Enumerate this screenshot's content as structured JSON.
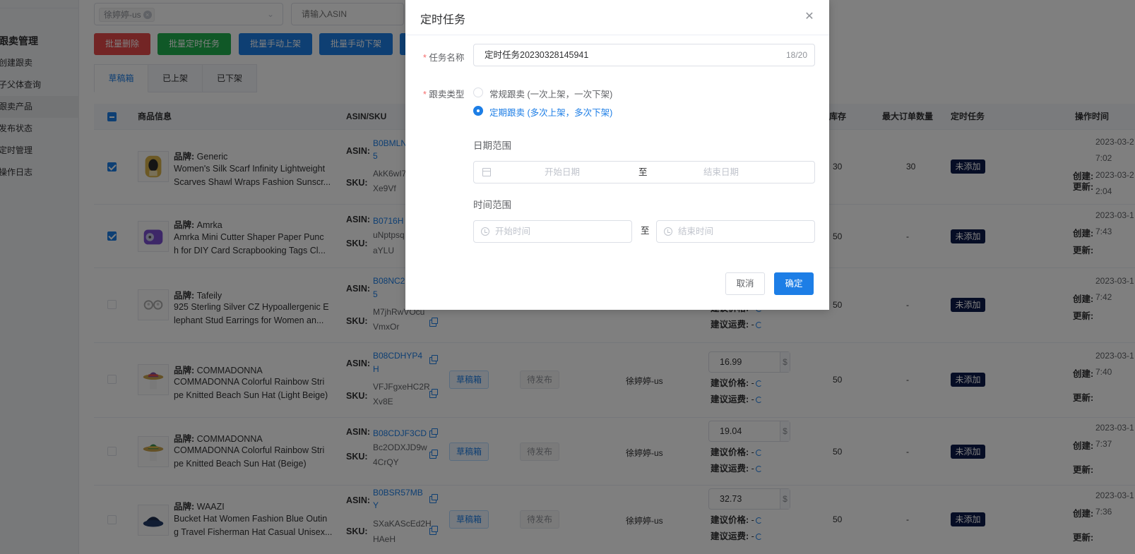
{
  "sidebar": {
    "group_title": "跟卖管理",
    "items": [
      {
        "label": "创建跟卖"
      },
      {
        "label": "子父体查询"
      },
      {
        "label": "跟卖产品"
      },
      {
        "label": "发布状态"
      },
      {
        "label": "定时管理"
      },
      {
        "label": "操作日志"
      }
    ]
  },
  "filters": {
    "store_tag": "徐婷婷-us",
    "asin_placeholder": "请输入ASIN"
  },
  "toolbar": {
    "delete": "批量删除",
    "schedule": "批量定时任务",
    "list_manual": "批量手动上架",
    "delist_manual": "批量手动下架"
  },
  "tabs": [
    "草稿箱",
    "已上架",
    "已下架"
  ],
  "table": {
    "headers": {
      "product": "商品信息",
      "asin_sku": "ASIN/SKU",
      "stock": "库存",
      "max_order": "最大订单数量",
      "schedule": "定时任务",
      "op_time": "操作时间"
    },
    "labels": {
      "brand": "品牌: ",
      "asin": "ASIN:",
      "sku": "SKU:",
      "suggest_price": "建议价格:",
      "suggest_ship": "建议运费:",
      "dash": "-",
      "created": "创建:",
      "updated": "更新:",
      "currency": "$"
    },
    "rows": [
      {
        "brand": "Generic",
        "title1": "Women's Silk Scarf Infinity Lightweight",
        "title2": "Scarves Shawl Wraps Fashion Sunscr...",
        "asin1": "B0BMLN",
        "asin2": "5",
        "sku1": "AkK6wI7c",
        "sku2": "Xe9Vf",
        "stock": "30",
        "max_order": "30",
        "schedule": "未添加",
        "created": "2023-03-2",
        "created_time": "7:02",
        "updated": "2023-03-2",
        "updated_time": "2:04",
        "checked": true
      },
      {
        "brand": "Amrka",
        "title1": "Amrka Mini Cutter Shaper Paper Punc",
        "title2": "h for DIY Card Scrapbooking Tags Cl...",
        "asin1": "B0716H",
        "sku1": "uNptpsq",
        "sku2": "aYLU",
        "stock": "50",
        "max_order": "-",
        "schedule": "未添加",
        "created": "2023-03-1",
        "created_time": "7:43",
        "checked": true
      },
      {
        "brand": "Tafeily",
        "title1": "925 Sterling Silver CZ Hypoallergenic E",
        "title2": "lephant Stud Earrings for Women an...",
        "asin1": "B08NC2",
        "asin2": "5",
        "sku1": "M7jhRwVOcu",
        "sku2": "VmxOr",
        "suggest_price": "建议价格: -",
        "stock": "50",
        "max_order": "-",
        "schedule": "未添加",
        "created": "2023-03-1",
        "created_time": "7:42",
        "checked": false
      },
      {
        "brand": "COMMADONNA",
        "title1": "COMMADONNA Colorful Rainbow Stri",
        "title2": "pe Knitted Beach Sun Hat (Light Beige)",
        "asin1": "B08CDHYP4",
        "asin2": "H",
        "sku1": "VFJFgxeHC2R",
        "sku2": "Xv8E",
        "draft": "草稿箱",
        "pending": "待发布",
        "store": "徐婷婷-us",
        "price": "16.99",
        "stock": "50",
        "max_order": "-",
        "schedule": "未添加",
        "created": "2023-03-1",
        "created_time": "7:40",
        "checked": false
      },
      {
        "brand": "COMMADONNA",
        "title1": "COMMADONNA Colorful Rainbow Stri",
        "title2": "pe Knitted Beach Sun Hat (Beige)",
        "asin1": "B08CDJF3CD",
        "sku1": "Bc2ODXJD9w",
        "sku2": "4CrQY",
        "draft": "草稿箱",
        "pending": "待发布",
        "store": "徐婷婷-us",
        "price": "19.04",
        "stock": "50",
        "max_order": "-",
        "schedule": "未添加",
        "created": "2023-03-1",
        "created_time": "7:37",
        "checked": false
      },
      {
        "brand": "WAAZI",
        "title1": "Bucket Hat Women Fashion Blue Outin",
        "title2": "g Travel Fisherman Hat Casual Unisex...",
        "asin1": "B0BSR57MB",
        "asin2": "Y",
        "sku1": "SXaKAScEd2H",
        "sku2": "HAeH",
        "draft": "草稿箱",
        "pending": "待发布",
        "store": "徐婷婷-us",
        "price": "32.73",
        "stock": "50",
        "max_order": "-",
        "schedule": "未添加",
        "created": "2023-03-1",
        "created_time": "7:36",
        "checked": false
      }
    ]
  },
  "dialog": {
    "title": "定时任务",
    "name_label": "任务名称",
    "name_value": "定时任务20230328145941",
    "name_count": "18/20",
    "type_label": "跟卖类型",
    "type_options": [
      "常规跟卖 (一次上架，一次下架)",
      "定期跟卖 (多次上架，多次下架)"
    ],
    "date_range_title": "日期范围",
    "start_date_placeholder": "开始日期",
    "range_sep": "至",
    "end_date_placeholder": "结束日期",
    "time_range_title": "时间范围",
    "start_time_placeholder": "开始时间",
    "end_time_placeholder": "结束时间",
    "cancel": "取消",
    "confirm": "确定",
    "required_mark": "*"
  }
}
